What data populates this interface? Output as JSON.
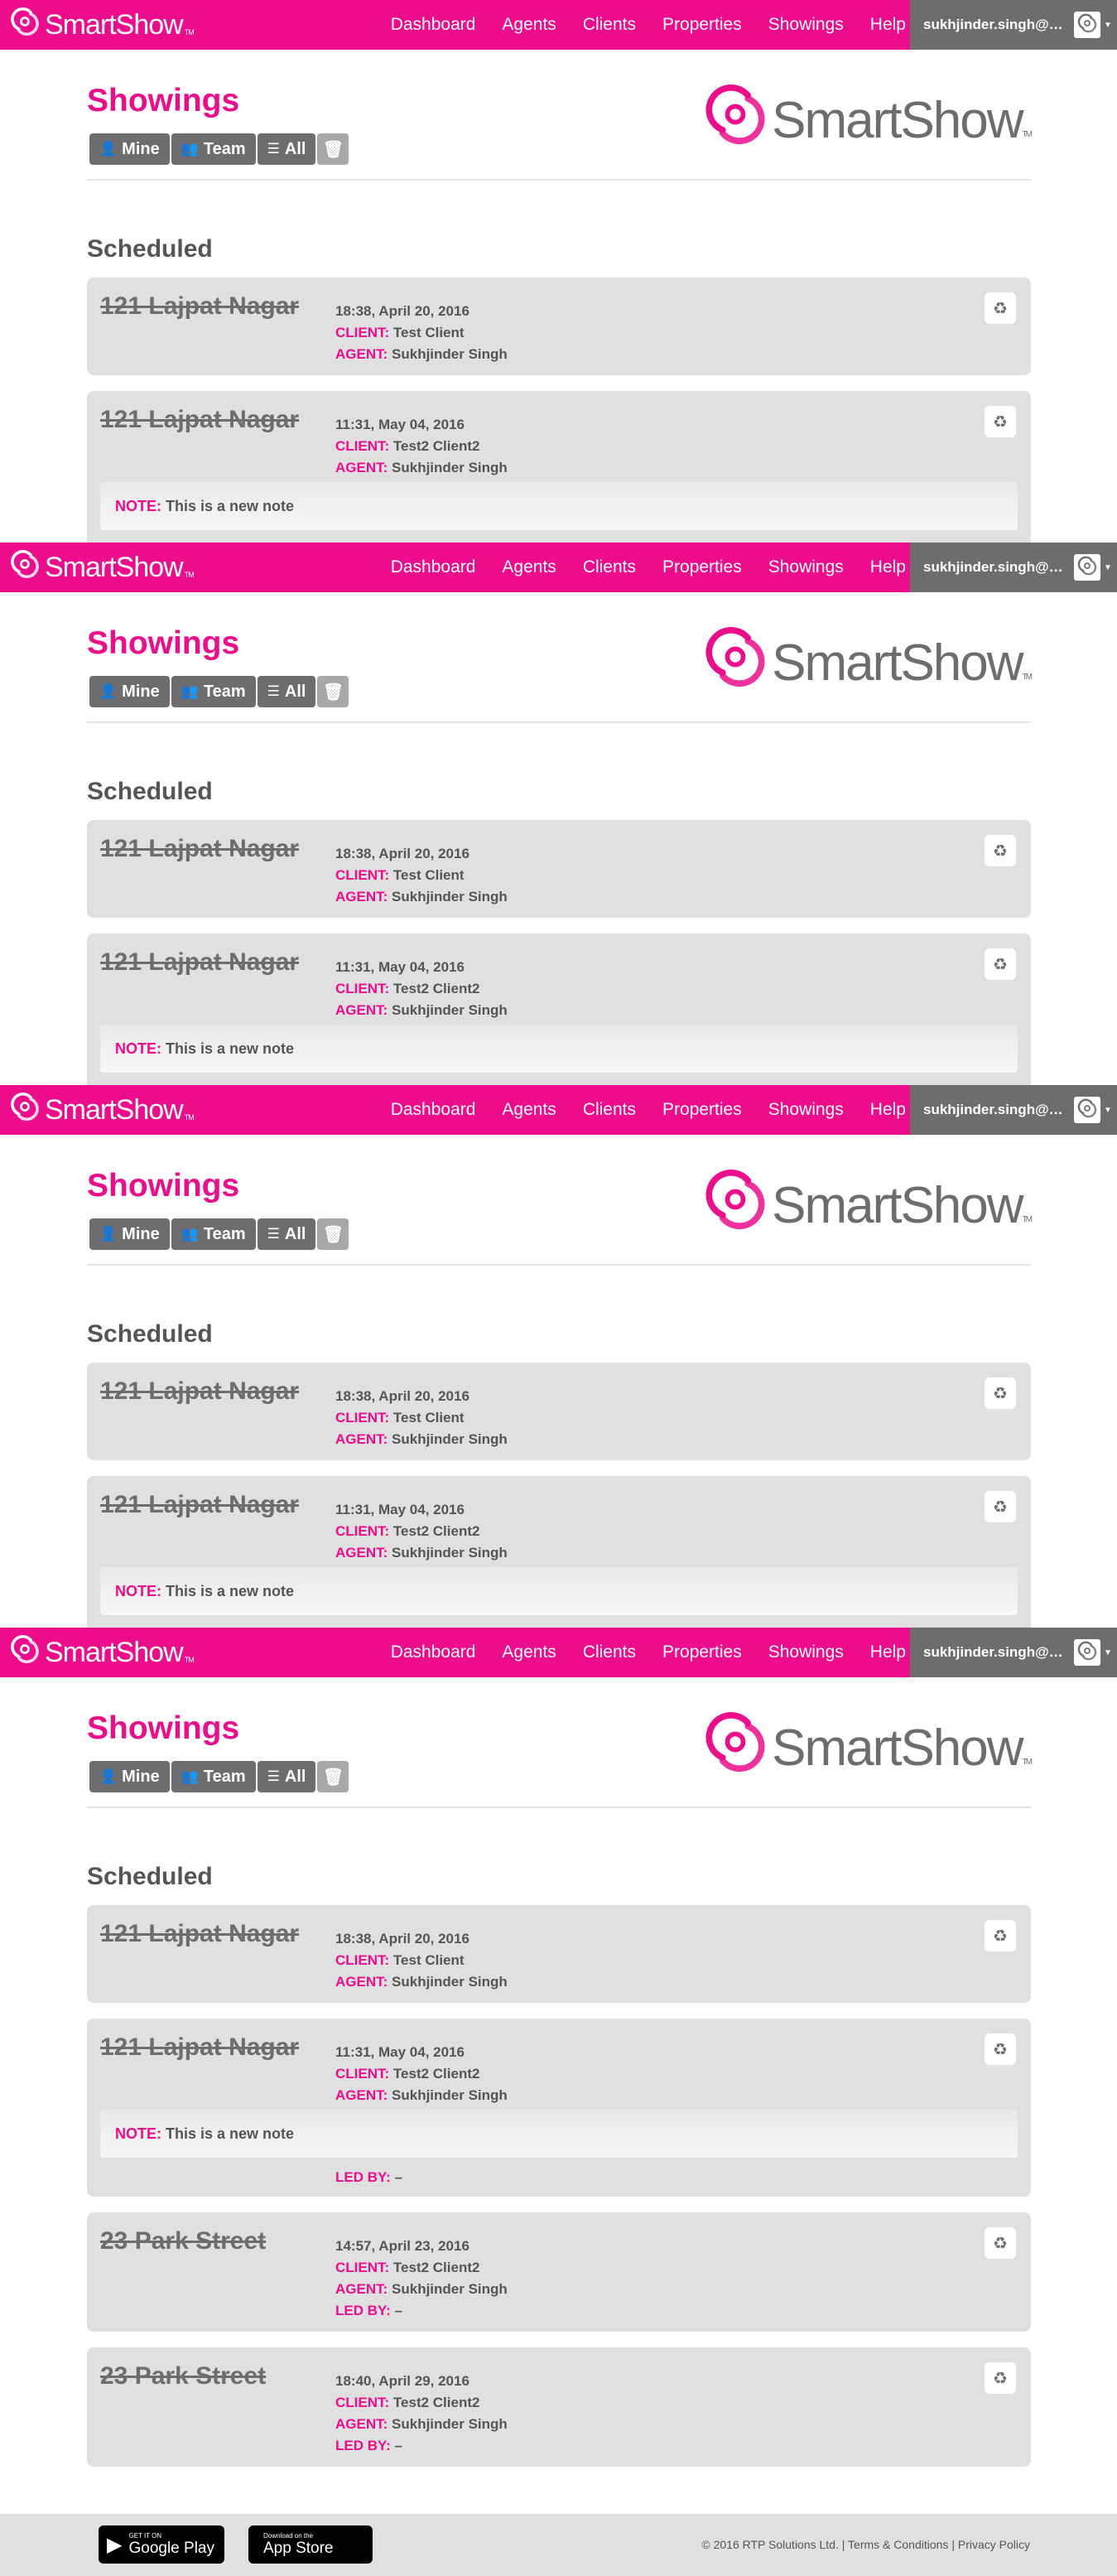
{
  "brand": {
    "name": "SmartShow",
    "tm": "TM"
  },
  "nav": {
    "links": [
      "Dashboard",
      "Agents",
      "Clients",
      "Properties",
      "Showings",
      "Help"
    ],
    "user_email": "sukhjinder.singh@d..."
  },
  "page": {
    "title": "Showings",
    "filters": [
      "Mine",
      "Team",
      "All"
    ],
    "section_title": "Scheduled"
  },
  "labels": {
    "client": "CLIENT:",
    "agent": "AGENT:",
    "note": "NOTE:",
    "led_by": "LED BY:"
  },
  "showings": [
    {
      "property": "121 Lajpat Nagar",
      "datetime": "18:38, April 20, 2016",
      "client": "Test Client",
      "agent": "Sukhjinder Singh"
    },
    {
      "property": "121 Lajpat Nagar",
      "datetime": "11:31, May 04, 2016",
      "client": "Test2 Client2",
      "agent": "Sukhjinder Singh",
      "note": "This is a new note",
      "led_by": "–"
    },
    {
      "property": "23 Park Street",
      "datetime": "14:57, April 23, 2016",
      "client": "Test2 Client2",
      "agent": "Sukhjinder Singh",
      "led_by": "–"
    },
    {
      "property": "23 Park Street",
      "datetime": "18:40, April 29, 2016",
      "client": "Test2 Client2",
      "agent": "Sukhjinder Singh",
      "led_by": "–"
    }
  ],
  "footer": {
    "google_small": "GET IT ON",
    "google_large": "Google Play",
    "apple_small": "Download on the",
    "apple_large": "App Store",
    "copyright": "© 2016 RTP Solutions Ltd.",
    "separator": "|",
    "terms": "Terms & Conditions",
    "privacy": "Privacy Policy"
  },
  "colors": {
    "brand_pink": "#ec0c8c",
    "dark_gray": "#6d6d70",
    "card_gray": "#e0e0e0"
  },
  "icons": [
    "smartshow-logo-icon",
    "user-icon",
    "users-icon",
    "list-icon",
    "trash-icon",
    "recycle-icon",
    "google-play-icon",
    "apple-icon",
    "caret-down-icon"
  ]
}
